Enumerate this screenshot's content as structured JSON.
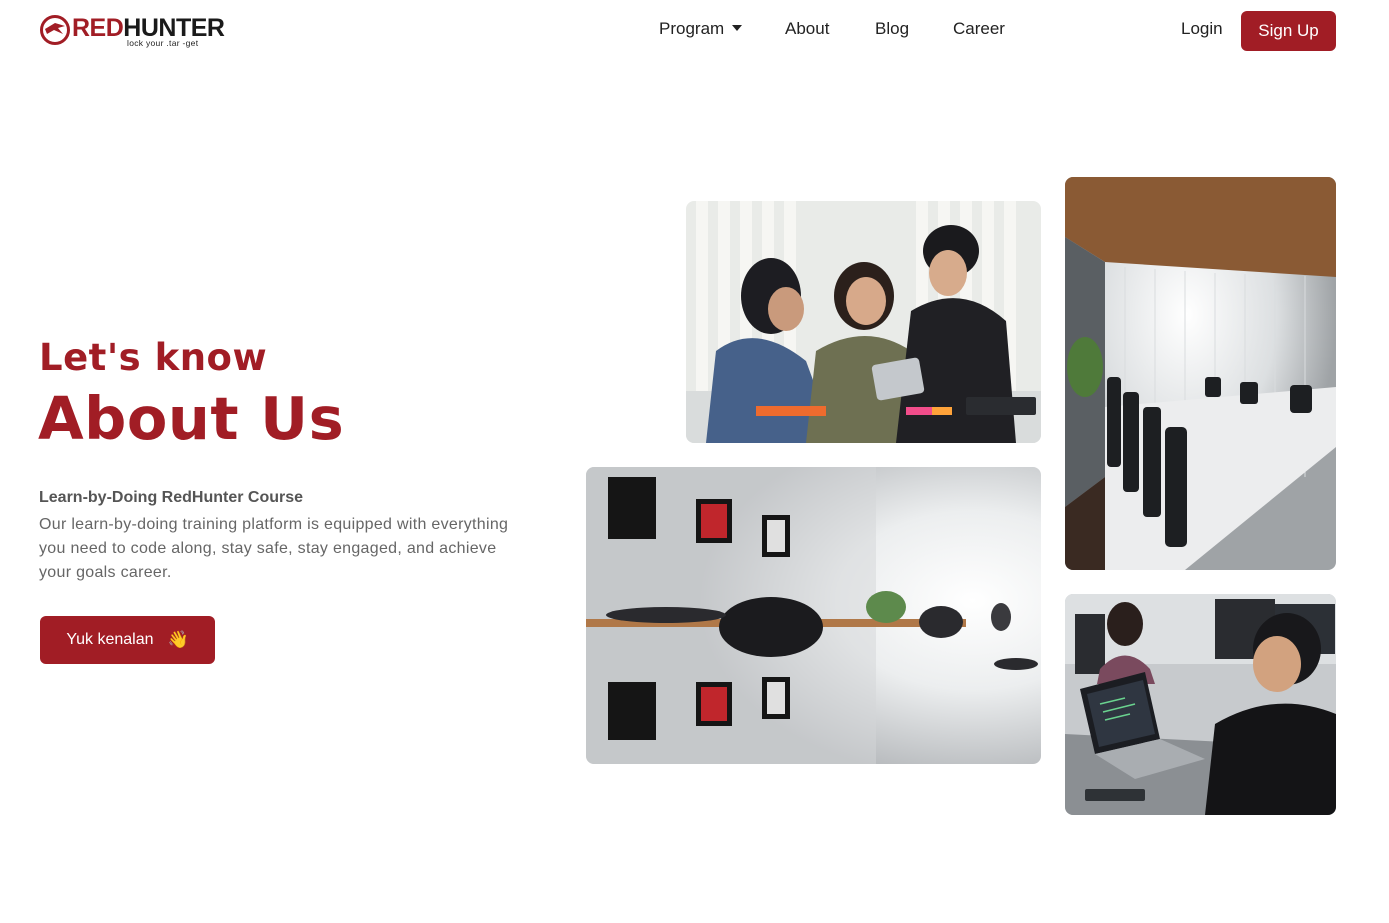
{
  "brand": {
    "name_red": "RED",
    "name_dark": "HUNTER",
    "tagline": "lock your .tar -get",
    "colors": {
      "primary": "#a11d25",
      "text": "#222222",
      "muted": "#666666"
    }
  },
  "nav": {
    "items": [
      {
        "label": "Program",
        "has_dropdown": true
      },
      {
        "label": "About"
      },
      {
        "label": "Blog"
      },
      {
        "label": "Career"
      }
    ],
    "login_label": "Login",
    "signup_label": "Sign Up"
  },
  "hero": {
    "subtitle": "Let's know",
    "title": "About Us",
    "course_title": "Learn-by-Doing RedHunter Course",
    "course_description": "Our learn-by-doing training platform is equipped with everything you need to code along, stay safe, stay engaged, and achieve your goals career.",
    "cta_label": "Yuk kenalan",
    "cta_emoji": "👋"
  },
  "gallery": {
    "icons": [
      "team-photo",
      "meeting-room-photo",
      "gallery-room-photo",
      "coding-photo"
    ]
  }
}
